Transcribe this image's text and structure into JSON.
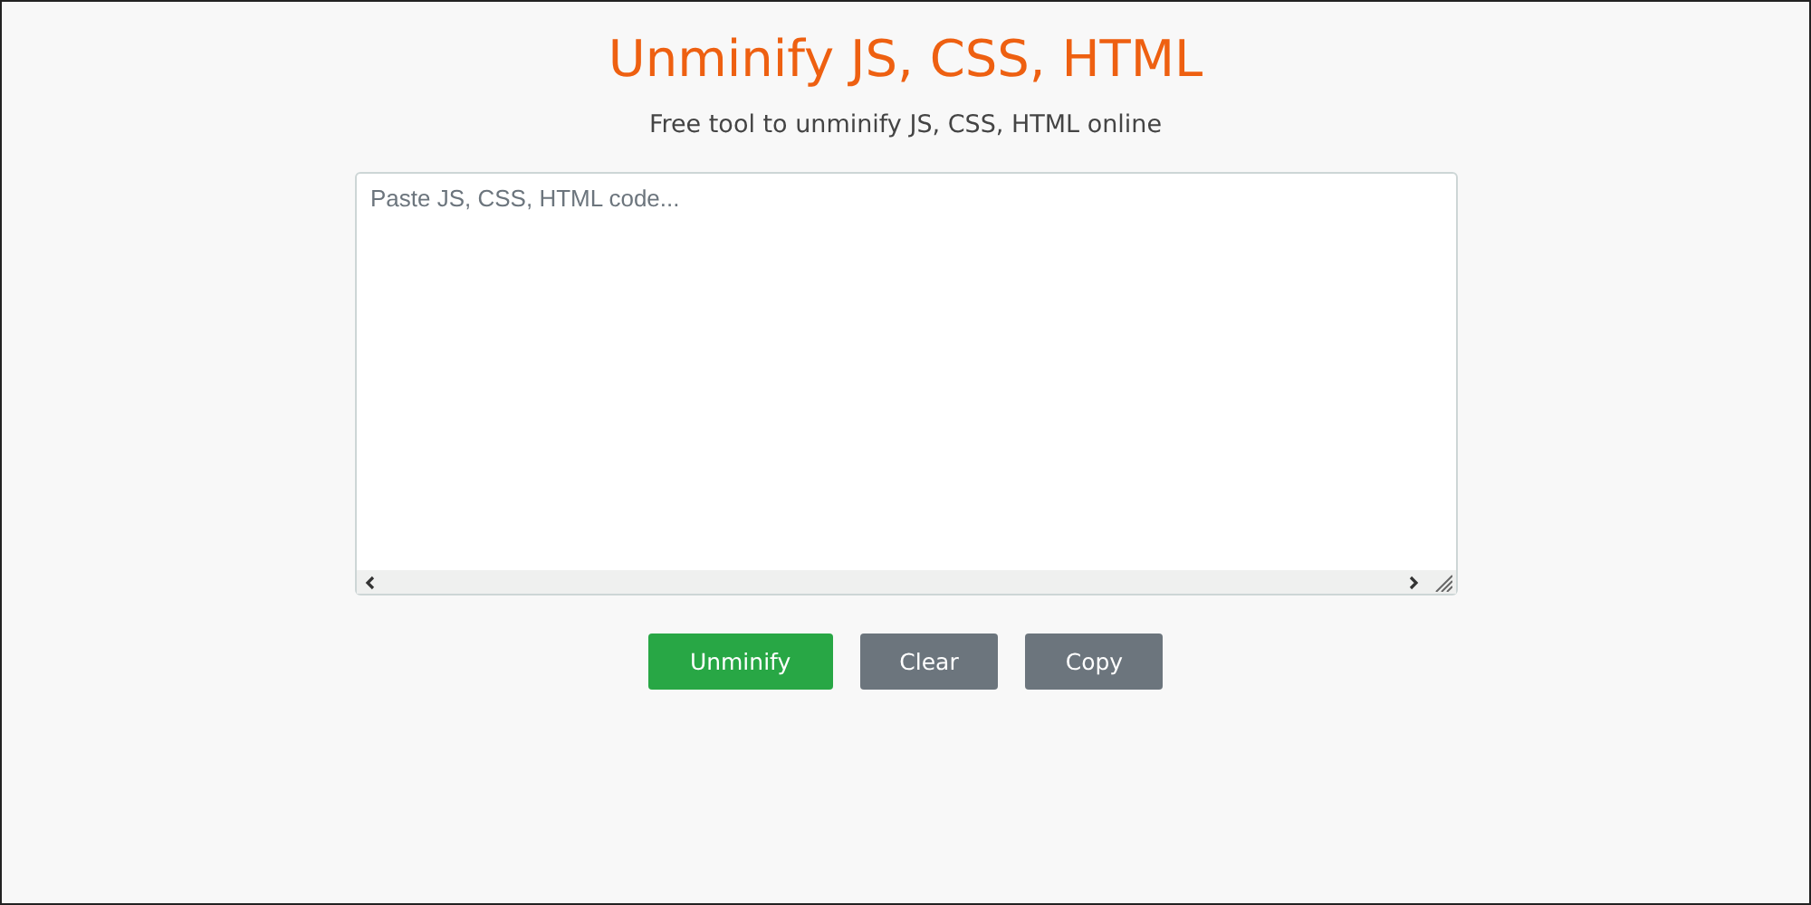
{
  "title": "Unminify JS, CSS, HTML",
  "subtitle": "Free tool to unminify JS, CSS, HTML online",
  "code_input": {
    "placeholder": "Paste JS, CSS, HTML code..."
  },
  "buttons": [
    {
      "label": "Unminify",
      "kind": "primary"
    },
    {
      "label": "Clear",
      "kind": "secondary"
    },
    {
      "label": "Copy",
      "kind": "secondary"
    }
  ]
}
